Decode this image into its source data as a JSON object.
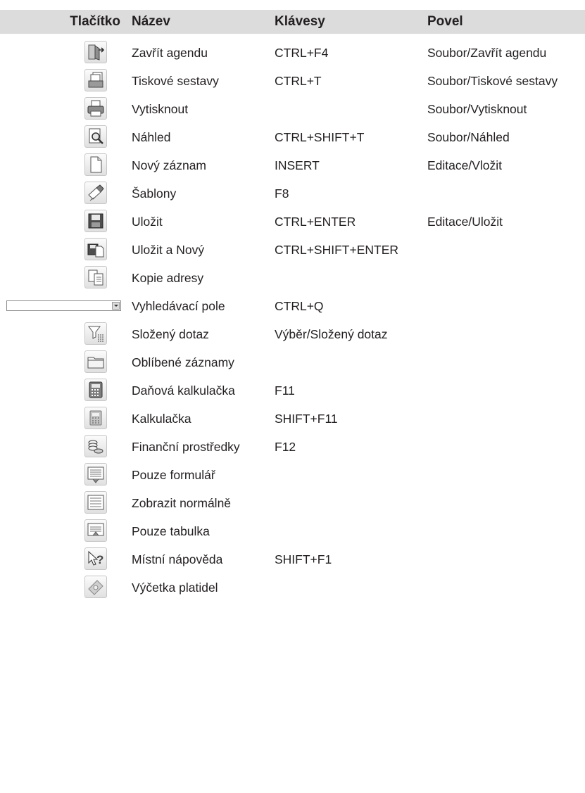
{
  "headers": {
    "button": "Tlačítko",
    "name": "Název",
    "keys": "Klávesy",
    "command": "Povel"
  },
  "rows": [
    {
      "icon": "close-agenda-icon",
      "name": "Zavřít agendu",
      "keys": "CTRL+F4",
      "command": "Soubor/Zavřít agendu"
    },
    {
      "icon": "print-reports-icon",
      "name": "Tiskové sestavy",
      "keys": "CTRL+T",
      "command": "Soubor/Tiskové sestavy"
    },
    {
      "icon": "printer-icon",
      "name": "Vytisknout",
      "keys": "",
      "command": "Soubor/Vytisknout"
    },
    {
      "icon": "print-preview-icon",
      "name": "Náhled",
      "keys": "CTRL+SHIFT+T",
      "command": "Soubor/Náhled"
    },
    {
      "icon": "new-record-icon",
      "name": "Nový záznam",
      "keys": "INSERT",
      "command": "Editace/Vložit"
    },
    {
      "icon": "templates-icon",
      "name": "Šablony",
      "keys": "F8",
      "command": ""
    },
    {
      "icon": "save-icon",
      "name": "Uložit",
      "keys": "CTRL+ENTER",
      "command": "Editace/Uložit"
    },
    {
      "icon": "save-and-new-icon",
      "name": "Uložit a Nový",
      "keys": "CTRL+SHIFT+ENTER",
      "command": ""
    },
    {
      "icon": "copy-address-icon",
      "name": "Kopie adresy",
      "keys": "",
      "command": ""
    },
    {
      "icon": "search-combo",
      "name": "Vyhledávací pole",
      "keys": "CTRL+Q",
      "command": ""
    },
    {
      "icon": "compound-query-icon",
      "name": "Složený dotaz",
      "keys": "Výběr/Složený dotaz",
      "command": ""
    },
    {
      "icon": "folder-icon",
      "name": "Oblíbené záznamy",
      "keys": "",
      "command": ""
    },
    {
      "icon": "tax-calculator-icon",
      "name": "Daňová kalkulačka",
      "keys": "F11",
      "command": ""
    },
    {
      "icon": "calculator-icon",
      "name": "Kalkulačka",
      "keys": "SHIFT+F11",
      "command": ""
    },
    {
      "icon": "coins-icon",
      "name": "Finanční prostředky",
      "keys": "F12",
      "command": ""
    },
    {
      "icon": "form-only-icon",
      "name": "Pouze formulář",
      "keys": "",
      "command": ""
    },
    {
      "icon": "normal-view-icon",
      "name": "Zobrazit normálně",
      "keys": "",
      "command": ""
    },
    {
      "icon": "table-only-icon",
      "name": "Pouze tabulka",
      "keys": "",
      "command": ""
    },
    {
      "icon": "context-help-icon",
      "name": "Místní nápověda",
      "keys": "SHIFT+F1",
      "command": ""
    },
    {
      "icon": "currency-count-icon",
      "name": "Výčetka platidel",
      "keys": "",
      "command": ""
    }
  ]
}
